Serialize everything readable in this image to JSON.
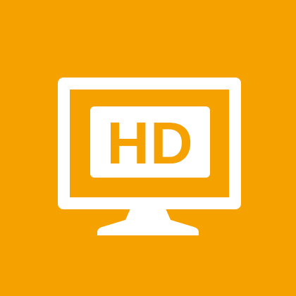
{
  "icon": {
    "name": "hd-monitor-icon",
    "label": "HD",
    "colors": {
      "background": "#F5A100",
      "foreground": "#FFFFFF"
    }
  }
}
